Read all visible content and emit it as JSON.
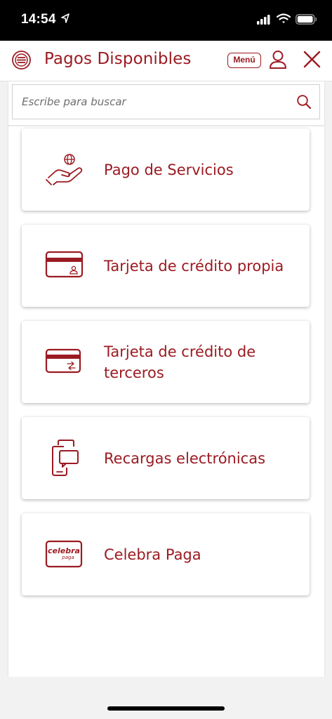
{
  "status_bar": {
    "time": "14:54"
  },
  "header": {
    "title": "Pagos Disponibles",
    "menu_label": "Menú"
  },
  "search": {
    "placeholder": "Escribe para buscar"
  },
  "payment_options": [
    {
      "label": "Pago de Servicios",
      "icon": "hand-globe-icon"
    },
    {
      "label": "Tarjeta de crédito propia",
      "icon": "credit-card-user-icon"
    },
    {
      "label": "Tarjeta de crédito de terceros",
      "icon": "credit-card-transfer-icon"
    },
    {
      "label": "Recargas electrónicas",
      "icon": "phone-recharge-icon"
    },
    {
      "label": "Celebra Paga",
      "icon": "celebra-paga-logo"
    }
  ],
  "logo_text": {
    "celebra": "celebra",
    "paga": "paga"
  },
  "colors": {
    "brand": "#9b1b22",
    "background": "#f2f2f2"
  }
}
